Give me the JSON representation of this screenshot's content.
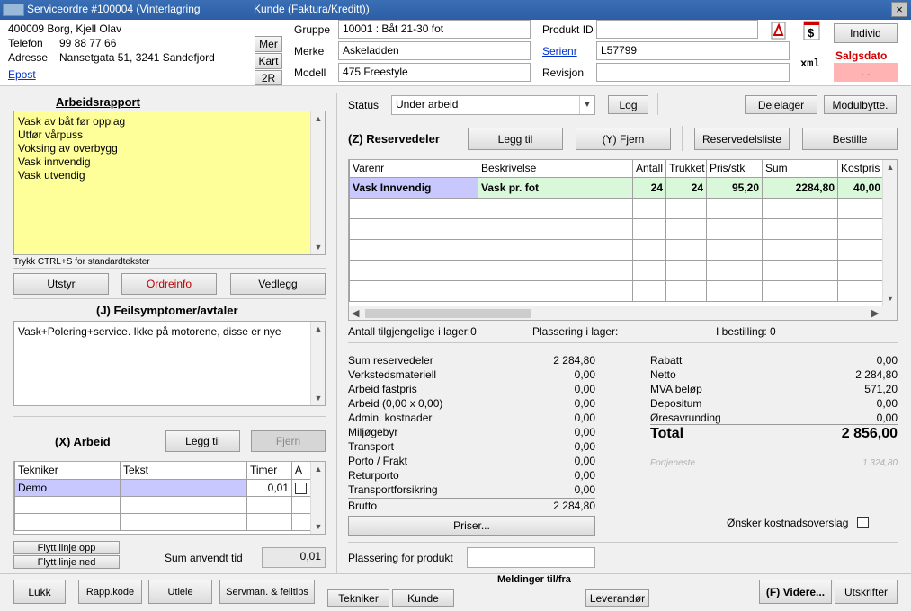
{
  "window": {
    "title": "Serviceordre #100004 (Vinterlagring",
    "subtitle": "Kunde (Faktura/Kreditt))",
    "close_glyph": "×"
  },
  "customer": {
    "number_name": "400009  Borg, Kjell Olav",
    "phone_label": "Telefon",
    "phone": "99 88 77 66",
    "address_label": "Adresse",
    "address": "Nansetgata 51, 3241 Sandefjord",
    "email_link": "Epost",
    "btn_more": "Mer",
    "btn_map": "Kart",
    "btn_2r": "2R"
  },
  "product": {
    "group_label": "Gruppe",
    "group_value": "10001 : Båt 21-30 fot",
    "brand_label": "Merke",
    "brand_value": "Askeladden",
    "model_label": "Modell",
    "model_value": "475 Freestyle",
    "product_id_label": "Produkt ID",
    "product_id_value": "",
    "serial_label": "Serienr",
    "serial_value": "L57799",
    "revision_label": "Revisjon",
    "revision_value": "",
    "btn_individ": "Individ",
    "sale_date_label": "Salgsdato",
    "sale_date_value": ". .",
    "xml_label": "xml"
  },
  "work_report": {
    "heading": "Arbeidsrapport",
    "lines": [
      "Vask av båt før opplag",
      "Utfør vårpuss",
      "Voksing av overbygg",
      "Vask innvendig",
      "Vask utvendig"
    ],
    "hint": "Trykk CTRL+S for standardtekster",
    "btn_equipment": "Utstyr",
    "btn_orderinfo": "Ordreinfo",
    "btn_attachment": "Vedlegg"
  },
  "symptoms": {
    "heading": "(J) Feilsymptomer/avtaler",
    "text": "Vask+Polering+service. Ikke på motorene, disse er nye"
  },
  "work": {
    "heading": "(X) Arbeid",
    "btn_add": "Legg til",
    "btn_remove": "Fjern",
    "columns": [
      "Tekniker",
      "Tekst",
      "Timer",
      "A"
    ],
    "rows": [
      {
        "tech": "Demo",
        "text": "",
        "hours": "0,01"
      }
    ],
    "btn_move_up": "Flytt linje opp",
    "btn_move_down": "Flytt linje ned",
    "sum_label": "Sum anvendt tid",
    "sum_value": "0,01"
  },
  "status": {
    "label": "Status",
    "value": "Under arbeid",
    "btn_log": "Log",
    "btn_parts_store": "Delelager",
    "btn_module_swap": "Modulbytte."
  },
  "parts": {
    "heading": "(Z) Reservedeler",
    "btn_add": "Legg til",
    "btn_remove": "(Y) Fjern",
    "btn_parts_list": "Reservedelsliste",
    "btn_order": "Bestille",
    "columns": [
      "Varenr",
      "Beskrivelse",
      "Antall",
      "Trukket",
      "Pris/stk",
      "Sum",
      "Kostpris"
    ],
    "rows": [
      {
        "item": "Vask Innvendig",
        "desc": "Vask pr. fot",
        "qty": "24",
        "drawn": "24",
        "price": "95,20",
        "sum": "2284,80",
        "cost": "40,00"
      }
    ],
    "stock_available": "Antall tilgjengelige i lager:0",
    "stock_location": "Plassering i lager:",
    "on_order": "I bestilling: 0"
  },
  "summary_left": [
    {
      "label": "Sum reservedeler",
      "value": "2 284,80"
    },
    {
      "label": "Verkstedsmateriell",
      "value": "0,00"
    },
    {
      "label": "Arbeid fastpris",
      "value": "0,00"
    },
    {
      "label": "Arbeid (0,00 x 0,00)",
      "value": "0,00"
    },
    {
      "label": "Admin. kostnader",
      "value": "0,00"
    },
    {
      "label": "Miljøgebyr",
      "value": "0,00"
    },
    {
      "label": "Transport",
      "value": "0,00"
    },
    {
      "label": "Porto / Frakt",
      "value": "0,00"
    },
    {
      "label": "Returporto",
      "value": "0,00"
    },
    {
      "label": "Transportforsikring",
      "value": "0,00"
    }
  ],
  "gross": {
    "label": "Brutto",
    "value": "2 284,80"
  },
  "btn_prices": "Priser...",
  "summary_right": [
    {
      "label": "Rabatt",
      "value": "0,00"
    },
    {
      "label": "Netto",
      "value": "2 284,80"
    },
    {
      "label": "MVA beløp",
      "value": "571,20"
    },
    {
      "label": "Depositum",
      "value": "0,00"
    },
    {
      "label": "Øresavrunding",
      "value": "0,00"
    }
  ],
  "total": {
    "label": "Total",
    "value": "2 856,00"
  },
  "profit": {
    "label": "Fortjeneste",
    "value": "1 324,80"
  },
  "cost_estimate_label": "Ønsker kostnadsoverslag",
  "product_location_label": "Plassering for produkt",
  "footer": {
    "btn_close": "Lukk",
    "btn_report_code": "Rapp.kode",
    "btn_rent": "Utleie",
    "btn_service_manual": "Servman. & feiltips",
    "messages_label": "Meldinger til/fra",
    "btn_technician": "Tekniker",
    "btn_customer": "Kunde",
    "btn_supplier": "Leverandør",
    "btn_forward": "(F) Videre...",
    "btn_printouts": "Utskrifter"
  }
}
